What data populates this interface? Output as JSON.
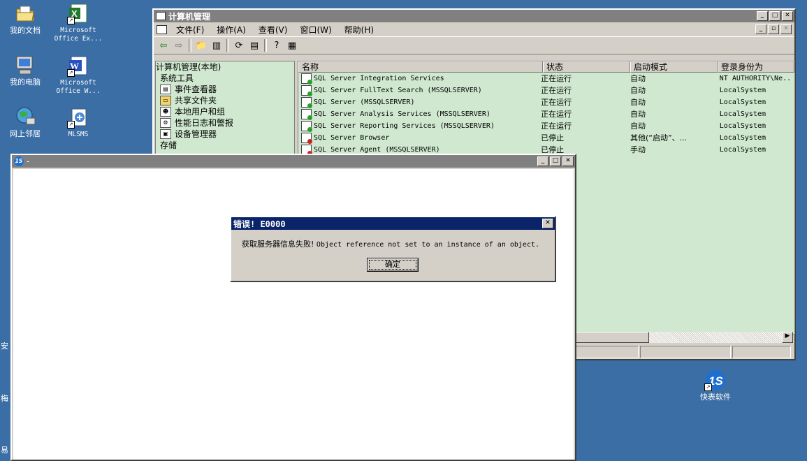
{
  "desktop": {
    "icons": [
      {
        "label": "我的文档",
        "icon": "my-documents-icon"
      },
      {
        "label": "Microsoft Office Ex...",
        "icon": "excel-icon"
      },
      {
        "label": "我的电脑",
        "icon": "my-computer-icon"
      },
      {
        "label": "Microsoft Office W...",
        "icon": "word-icon"
      },
      {
        "label": "网上邻居",
        "icon": "network-icon"
      },
      {
        "label": "MLSMS",
        "icon": "mlsms-icon"
      },
      {
        "label": "快表软件",
        "icon": "kuaibiao-icon"
      }
    ],
    "edge_labels": [
      "安",
      "梅",
      "易"
    ]
  },
  "mmc": {
    "title": "计算机管理",
    "menu": [
      "文件(F)",
      "操作(A)",
      "查看(V)",
      "窗口(W)",
      "帮助(H)"
    ],
    "tree": [
      "计算机管理(本地)",
      "系统工具",
      "事件查看器",
      "共享文件夹",
      "本地用户和组",
      "性能日志和警报",
      "设备管理器",
      "存储"
    ],
    "columns": [
      "名称",
      "状态",
      "启动模式",
      "登录身份为"
    ],
    "rows": [
      {
        "name": "SQL Server Integration Services",
        "status": "正在运行",
        "mode": "自动",
        "logon": "NT AUTHORITY\\Ne..",
        "color": "#2a9d2a"
      },
      {
        "name": "SQL Server FullText Search (MSSQLSERVER)",
        "status": "正在运行",
        "mode": "自动",
        "logon": "LocalSystem",
        "color": "#2a9d2a"
      },
      {
        "name": "SQL Server (MSSQLSERVER)",
        "status": "正在运行",
        "mode": "自动",
        "logon": "LocalSystem",
        "color": "#2a9d2a"
      },
      {
        "name": "SQL Server Analysis Services (MSSQLSERVER)",
        "status": "正在运行",
        "mode": "自动",
        "logon": "LocalSystem",
        "color": "#2a9d2a"
      },
      {
        "name": "SQL Server Reporting Services (MSSQLSERVER)",
        "status": "正在运行",
        "mode": "自动",
        "logon": "LocalSystem",
        "color": "#2a9d2a"
      },
      {
        "name": "SQL Server Browser",
        "status": "已停止",
        "mode": "其他(“启动”、...",
        "logon": "LocalSystem",
        "color": "#cc2020"
      },
      {
        "name": "SQL Server Agent (MSSQLSERVER)",
        "status": "已停止",
        "mode": "手动",
        "logon": "LocalSystem",
        "color": "#cc2020"
      }
    ]
  },
  "app_window": {
    "title": "-"
  },
  "error_dialog": {
    "title": "错误! E0000",
    "message_cn": "获取服务器信息失败!",
    "message_en": "Object reference not set to an instance of an object.",
    "ok_label": "确定"
  }
}
